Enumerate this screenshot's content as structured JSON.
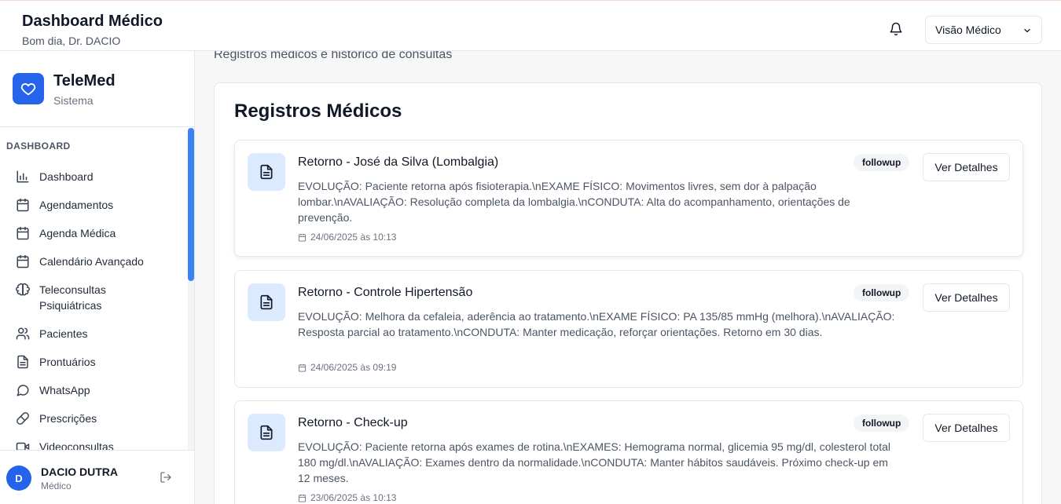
{
  "header": {
    "title": "Dashboard Médico",
    "greeting": "Bom dia, Dr. DACIO",
    "view_select": "Visão Médico"
  },
  "brand": {
    "name": "TeleMed",
    "sub": "Sistema"
  },
  "sidebar": {
    "section": "DASHBOARD",
    "items": [
      {
        "label": "Dashboard",
        "icon": "bar-chart-icon"
      },
      {
        "label": "Agendamentos",
        "icon": "calendar-icon"
      },
      {
        "label": "Agenda Médica",
        "icon": "calendar-icon"
      },
      {
        "label": "Calendário Avançado",
        "icon": "calendar-icon"
      },
      {
        "label": "Teleconsultas Psiquiátricas",
        "icon": "brain-icon"
      },
      {
        "label": "Pacientes",
        "icon": "users-icon"
      },
      {
        "label": "Prontuários",
        "icon": "file-text-icon"
      },
      {
        "label": "WhatsApp",
        "icon": "message-circle-icon"
      },
      {
        "label": "Prescrições",
        "icon": "pill-icon"
      },
      {
        "label": "Videoconsultas",
        "icon": "video-icon"
      }
    ]
  },
  "user": {
    "initial": "D",
    "name": "DACIO DUTRA",
    "role": "Médico"
  },
  "main": {
    "description": "Registros médicos e histórico de consultas",
    "panel_title": "Registros Médicos",
    "details_label": "Ver Detalhes",
    "records": [
      {
        "title": "Retorno - José da Silva (Lombalgia)",
        "badge": "followup",
        "text": "EVOLUÇÃO: Paciente retorna após fisioterapia.\\nEXAME FÍSICO: Movimentos livres, sem dor à palpação lombar.\\nAVALIAÇÃO: Resolução completa da lombalgia.\\nCONDUTA: Alta do acompanhamento, orientações de prevenção.",
        "date": "24/06/2025 às 10:13"
      },
      {
        "title": "Retorno - Controle Hipertensão",
        "badge": "followup",
        "text": "EVOLUÇÃO: Melhora da cefaleia, aderência ao tratamento.\\nEXAME FÍSICO: PA 135/85 mmHg (melhora).\\nAVALIAÇÃO: Resposta parcial ao tratamento.\\nCONDUTA: Manter medicação, reforçar orientações. Retorno em 30 dias.",
        "date": "24/06/2025 às 09:19"
      },
      {
        "title": "Retorno - Check-up",
        "badge": "followup",
        "text": "EVOLUÇÃO: Paciente retorna após exames de rotina.\\nEXAMES: Hemograma normal, glicemia 95 mg/dl, colesterol total 180 mg/dl.\\nAVALIAÇÃO: Exames dentro da normalidade.\\nCONDUTA: Manter hábitos saudáveis. Próximo check-up em 12 meses.",
        "date": "23/06/2025 às 10:13"
      }
    ]
  },
  "colors": {
    "accent": "#2563eb",
    "accent_light": "#dbeafe",
    "scroll_thumb": "#3b82f6"
  }
}
